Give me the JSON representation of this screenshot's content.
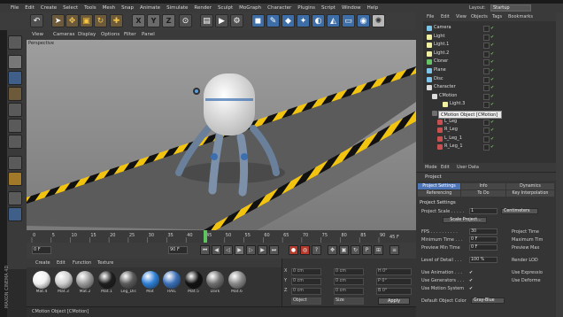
{
  "menubar": {
    "items": [
      "File",
      "Edit",
      "Create",
      "Select",
      "Tools",
      "Mesh",
      "Snap",
      "Animate",
      "Simulate",
      "Render",
      "Sculpt",
      "MoGraph",
      "Character",
      "Plugins",
      "Script",
      "Window",
      "Help"
    ]
  },
  "layout": {
    "label": "Layout:",
    "value": "Startup"
  },
  "toolbar": {
    "x_label": "X",
    "y_label": "Y",
    "z_label": "Z"
  },
  "viewport": {
    "menu": [
      "View",
      "Cameras",
      "Display",
      "Options",
      "Filter",
      "Panel"
    ],
    "label": "Perspective"
  },
  "timeline": {
    "ticks": [
      "0",
      "5",
      "10",
      "15",
      "20",
      "25",
      "30",
      "35",
      "40",
      "45",
      "50",
      "55",
      "60",
      "65",
      "70",
      "75",
      "80",
      "85",
      "90"
    ],
    "end_label": "45 F",
    "current_frame": 45
  },
  "animbar": {
    "start_field": "0 F",
    "end_field": "90 F"
  },
  "materials": {
    "menu": [
      "Create",
      "Edit",
      "Function",
      "Texture"
    ],
    "items": [
      {
        "label": "Mat.4",
        "color": "#f0f0f0"
      },
      {
        "label": "Mat.3",
        "color": "#cfcfcf"
      },
      {
        "label": "Mat.2",
        "color": "#9a9a9a"
      },
      {
        "label": "Mat.1",
        "color": "#1e1e1e"
      },
      {
        "label": "Leg_Dis",
        "color": "#5a5a5a"
      },
      {
        "label": "Mat",
        "color": "#2d7fd6"
      },
      {
        "label": "RAIL",
        "color": "#3a6fb8"
      },
      {
        "label": "Mat.5",
        "color": "#111111"
      },
      {
        "label": "Dark",
        "color": "#6e6e6e"
      },
      {
        "label": "Mat.6",
        "color": "#888888"
      }
    ]
  },
  "coords": {
    "rows": [
      {
        "label": "X",
        "v1": "0 cm",
        "v2": "0 cm",
        "v3": "H 0°"
      },
      {
        "label": "Y",
        "v1": "0 cm",
        "v2": "0 cm",
        "v3": "P 0°"
      },
      {
        "label": "Z",
        "v1": "0 cm",
        "v2": "0 cm",
        "v3": "B 0°"
      }
    ],
    "dropdown1": "Object",
    "dropdown2": "Size",
    "apply": "Apply"
  },
  "statusbar": {
    "text": "CMotion Object [CMotion]"
  },
  "objmgr": {
    "tabs": [
      "File",
      "Edit",
      "View",
      "Objects",
      "Tags",
      "Bookmarks"
    ],
    "rows": [
      {
        "name": "Camera",
        "indent": 0,
        "color": "#7ec4e8"
      },
      {
        "name": "Light",
        "indent": 0,
        "color": "#f0f0a0"
      },
      {
        "name": "Light.1",
        "indent": 0,
        "color": "#f0f0a0"
      },
      {
        "name": "Light.2",
        "indent": 0,
        "color": "#f0f0a0"
      },
      {
        "name": "Cloner",
        "indent": 0,
        "color": "#66c266"
      },
      {
        "name": "Plane",
        "indent": 0,
        "color": "#7ec4e8"
      },
      {
        "name": "Disc",
        "indent": 0,
        "color": "#7ec4e8"
      },
      {
        "name": "Character",
        "indent": 0,
        "color": "#dcdcdc"
      },
      {
        "name": "CMotion",
        "indent": 1,
        "color": "#dcdcdc"
      },
      {
        "name": "Light.3",
        "indent": 3,
        "color": "#f0f0a0"
      },
      {
        "name": "",
        "indent": 1,
        "color": "#6f6f6f"
      },
      {
        "name": "L_Leg",
        "indent": 2,
        "color": "#c85050"
      },
      {
        "name": "R_Leg",
        "indent": 2,
        "color": "#c85050"
      },
      {
        "name": "L_Leg_1",
        "indent": 2,
        "color": "#c85050"
      },
      {
        "name": "R_Leg_1",
        "indent": 2,
        "color": "#c85050"
      }
    ],
    "tooltip": "CMotion Object [CMotion]"
  },
  "attrmgr": {
    "tabs": [
      "Mode",
      "Edit",
      "User Data"
    ],
    "header": "Project",
    "subtabs": [
      "Project Settings",
      "Info",
      "Dynamics",
      "Referencing",
      "To Do",
      "Key Interpolation"
    ],
    "section": "Project Settings",
    "project_scale_label": "Project Scale . . . . .",
    "project_scale_value": "1",
    "project_scale_unit": "Centimeters",
    "scale_button": "Scale Project...",
    "fps_label": "FPS . . . . . . . . . .",
    "fps_value": "30",
    "min_time_label": "Minimum Time . . .",
    "min_time_value": "0 F",
    "preview_min_label": "Preview Min Time",
    "preview_min_value": "0 F",
    "lod_label": "Level of Detail . . .",
    "lod_value": "100 %",
    "right_col": [
      "Project Time",
      "Maximum Tim",
      "Preview Max",
      "Render LOD"
    ],
    "use_animation": "Use Animation . . .",
    "use_generators": "Use Generators . . .",
    "use_motion": "Use Motion System",
    "right_checks": [
      "Use Expressio",
      "Use Deforme"
    ],
    "default_color_label": "Default Object Color",
    "default_color_value": "Gray-Blue"
  }
}
